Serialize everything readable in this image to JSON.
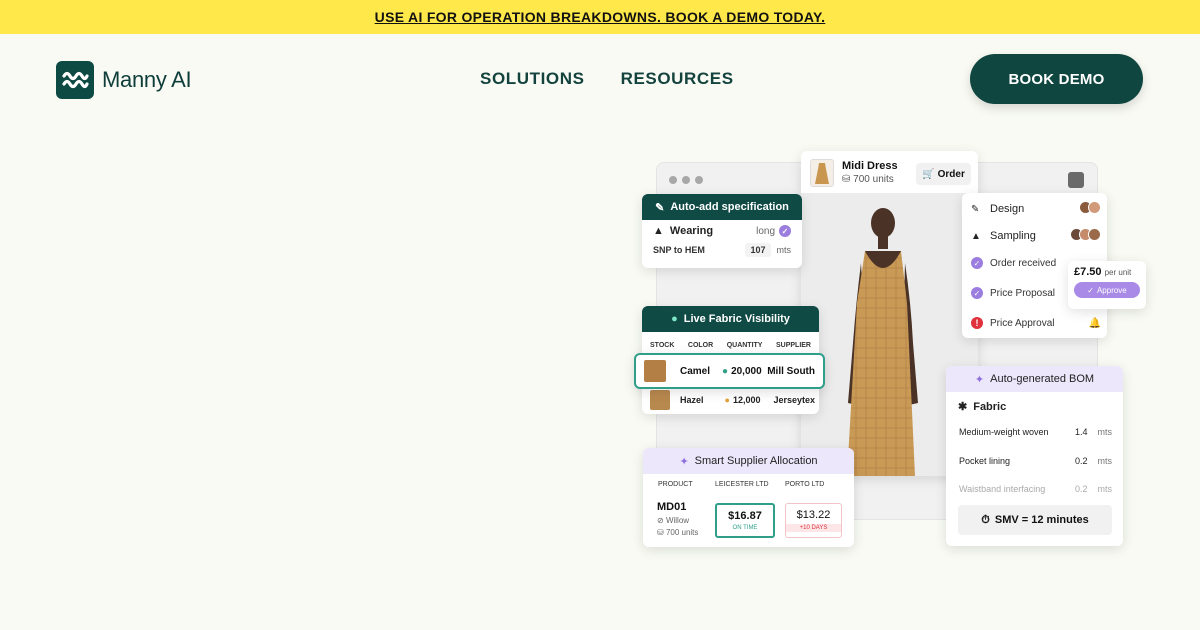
{
  "banner": {
    "text": "USE AI FOR OPERATION BREAKDOWNS. BOOK A DEMO TODAY."
  },
  "brand": {
    "name": "Manny AI"
  },
  "nav": {
    "items": [
      "SOLUTIONS",
      "RESOURCES"
    ]
  },
  "cta": {
    "label": "BOOK DEMO"
  },
  "colors": {
    "banner": "#ffe94a",
    "brand": "#0f4640",
    "accent": "#9b7de0",
    "background": "#f9faf4"
  },
  "spec": {
    "title": "Auto-add specification",
    "item": "Wearing",
    "fit": "long",
    "measure_label": "SNP to HEM",
    "measure_value": "107",
    "measure_unit": "mts"
  },
  "product": {
    "name": "Midi Dress",
    "units": "700 units",
    "order_label": "Order"
  },
  "fabric_visibility": {
    "title": "Live Fabric Visibility",
    "columns": [
      "STOCK",
      "COLOR",
      "QUANTITY",
      "SUPPLIER"
    ],
    "rows": [
      {
        "color": "Camel",
        "quantity": "20,000",
        "supplier": "Mill South"
      },
      {
        "color": "Hazel",
        "quantity": "12,000",
        "supplier": "Jerseytex"
      }
    ]
  },
  "workflow": {
    "steps": [
      "Design",
      "Sampling"
    ],
    "statuses": [
      "Order received",
      "Price Proposal",
      "Price Approval"
    ]
  },
  "price_popup": {
    "price": "£7.50",
    "per": "per unit",
    "approve_label": "Approve"
  },
  "bom": {
    "title": "Auto-generated BOM",
    "section": "Fabric",
    "rows": [
      {
        "name": "Medium-weight woven",
        "value": "1.4",
        "unit": "mts"
      },
      {
        "name": "Pocket lining",
        "value": "0.2",
        "unit": "mts"
      },
      {
        "name": "Waistband interfacing",
        "value": "0.2",
        "unit": "mts"
      }
    ],
    "smv": "SMV = 12 minutes"
  },
  "allocation": {
    "title": "Smart Supplier Allocation",
    "columns": [
      "PRODUCT",
      "LEICESTER LTD",
      "PORTO LTD"
    ],
    "product": "MD01",
    "style": "Willow",
    "units": "700 units",
    "offer_a": {
      "price": "$16.87",
      "note": "ON TIME"
    },
    "offer_b": {
      "price": "$13.22",
      "note": "+10 DAYS"
    }
  }
}
